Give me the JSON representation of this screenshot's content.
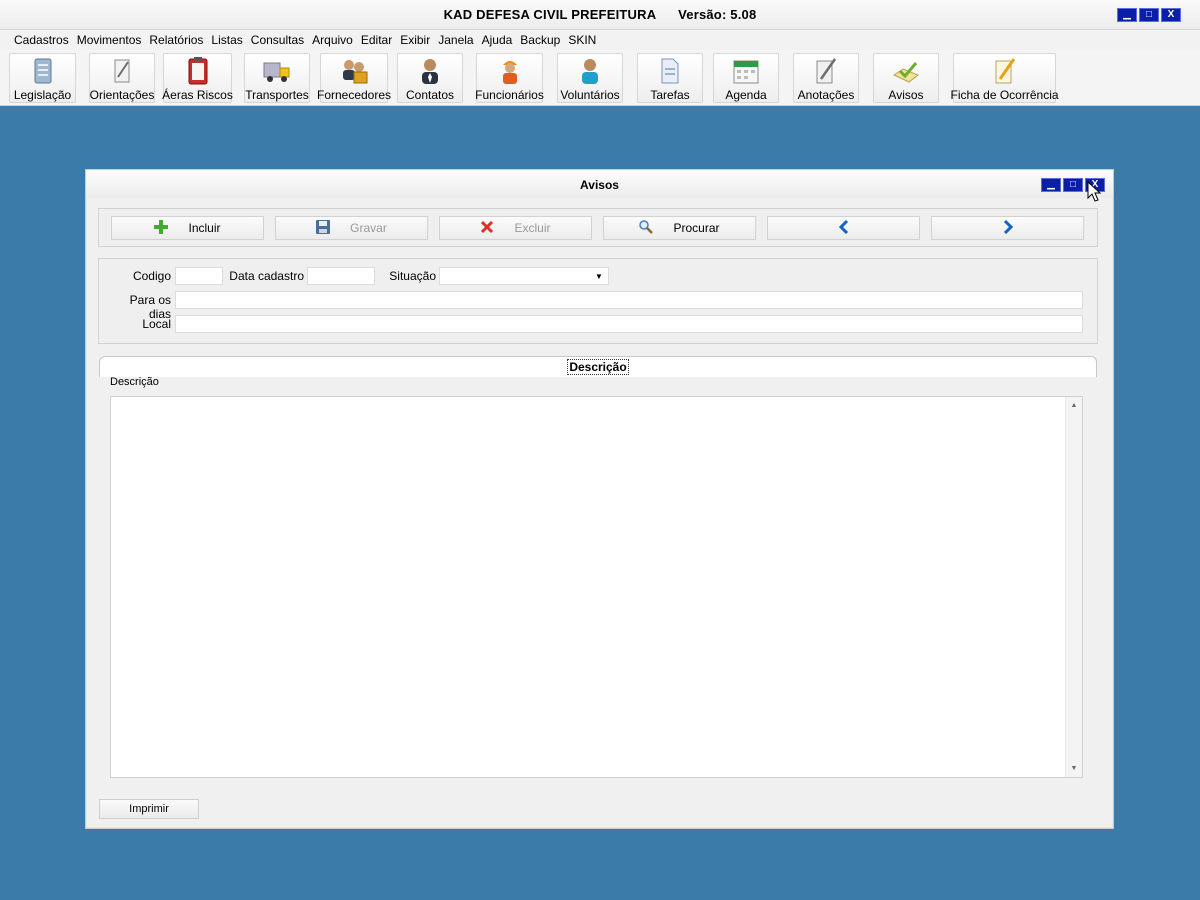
{
  "app": {
    "title": "KAD DEFESA CIVIL PREFEITURA",
    "version": "Versão: 5.08",
    "controls": {
      "minimize": "▁",
      "maximize": "□",
      "close": "X"
    }
  },
  "menu": [
    "Cadastros",
    "Movimentos",
    "Relatórios",
    "Listas",
    "Consultas",
    "Arquivo",
    "Editar",
    "Exibir",
    "Janela",
    "Ajuda",
    "Backup",
    "SKIN"
  ],
  "toolbar": [
    {
      "label": "Legislação",
      "icon": "document-icon"
    },
    {
      "label": "Orientações",
      "icon": "note-pencil-icon"
    },
    {
      "label": "Áeras Riscos",
      "icon": "clipboard-icon"
    },
    {
      "label": "Transportes",
      "icon": "truck-icon"
    },
    {
      "label": "Fornecedores",
      "icon": "suppliers-icon"
    },
    {
      "label": "Contatos",
      "icon": "contact-person-icon"
    },
    {
      "label": "Funcionários",
      "icon": "worker-icon"
    },
    {
      "label": "Voluntários",
      "icon": "volunteer-icon"
    },
    {
      "label": "Tarefas",
      "icon": "task-page-icon"
    },
    {
      "label": "Agenda",
      "icon": "calendar-icon"
    },
    {
      "label": "Anotações",
      "icon": "notepad-icon"
    },
    {
      "label": "Avisos",
      "icon": "checkmark-icon"
    },
    {
      "label": "Ficha de Ocorrência",
      "icon": "form-pencil-icon"
    }
  ],
  "window": {
    "title": "Avisos",
    "actions": {
      "include": "Incluir",
      "save": "Gravar",
      "delete": "Excluir",
      "search": "Procurar"
    },
    "fields": {
      "code_label": "Codigo",
      "code_value": "",
      "date_label": "Data cadastro",
      "date_value": "",
      "status_label": "Situação",
      "status_value": "",
      "days_label": "Para os dias",
      "days_value": "",
      "local_label": "Local",
      "local_value": ""
    },
    "tab": {
      "title": "Descrição"
    },
    "description_label": "Descrição",
    "description_value": "",
    "print": "Imprimir"
  },
  "colors": {
    "desktop": "#3a7ba9",
    "title_button": "#0a1ea8",
    "include_icon": "#3fae2a",
    "delete_icon": "#d9312b",
    "nav_arrow": "#1565c0"
  }
}
